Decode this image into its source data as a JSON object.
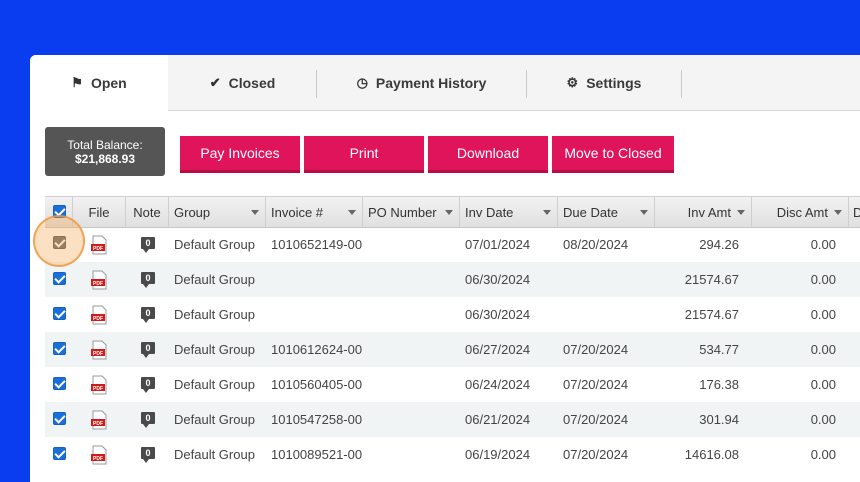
{
  "tabs": [
    {
      "label": "Open",
      "icon": "flag-icon"
    },
    {
      "label": "Closed",
      "icon": "check-icon"
    },
    {
      "label": "Payment History",
      "icon": "clock-icon"
    },
    {
      "label": "Settings",
      "icon": "gear-icon"
    }
  ],
  "balance": {
    "label": "Total Balance:",
    "value": "$21,868.93"
  },
  "buttons": {
    "pay": "Pay Invoices",
    "print": "Print",
    "download": "Download",
    "move": "Move to Closed"
  },
  "columns": {
    "file": "File",
    "note": "Note",
    "group": "Group",
    "invoice": "Invoice #",
    "po": "PO Number",
    "inv_date": "Inv Date",
    "due_date": "Due Date",
    "inv_amt": "Inv Amt",
    "disc_amt": "Disc Amt",
    "next": "D"
  },
  "rows": [
    {
      "group": "Default Group",
      "invoice": "1010652149-00",
      "po": "",
      "inv_date": "07/01/2024",
      "due_date": "08/20/2024",
      "inv_amt": "294.26",
      "disc_amt": "0.00"
    },
    {
      "group": "Default Group",
      "invoice": "",
      "po": "",
      "inv_date": "06/30/2024",
      "due_date": "",
      "inv_amt": "21574.67",
      "disc_amt": "0.00"
    },
    {
      "group": "Default Group",
      "invoice": "",
      "po": "",
      "inv_date": "06/30/2024",
      "due_date": "",
      "inv_amt": "21574.67",
      "disc_amt": "0.00"
    },
    {
      "group": "Default Group",
      "invoice": "1010612624-00",
      "po": "",
      "inv_date": "06/27/2024",
      "due_date": "07/20/2024",
      "inv_amt": "534.77",
      "disc_amt": "0.00"
    },
    {
      "group": "Default Group",
      "invoice": "1010560405-00",
      "po": "",
      "inv_date": "06/24/2024",
      "due_date": "07/20/2024",
      "inv_amt": "176.38",
      "disc_amt": "0.00"
    },
    {
      "group": "Default Group",
      "invoice": "1010547258-00",
      "po": "",
      "inv_date": "06/21/2024",
      "due_date": "07/20/2024",
      "inv_amt": "301.94",
      "disc_amt": "0.00"
    },
    {
      "group": "Default Group",
      "invoice": "1010089521-00",
      "po": "",
      "inv_date": "06/19/2024",
      "due_date": "07/20/2024",
      "inv_amt": "14616.08",
      "disc_amt": "0.00"
    }
  ],
  "note_icon_text": "0",
  "pdf_icon_text": "PDF",
  "colors": {
    "background": "#0a3df0",
    "accent": "#e0145a",
    "checkbox": "#1a6fd8"
  }
}
